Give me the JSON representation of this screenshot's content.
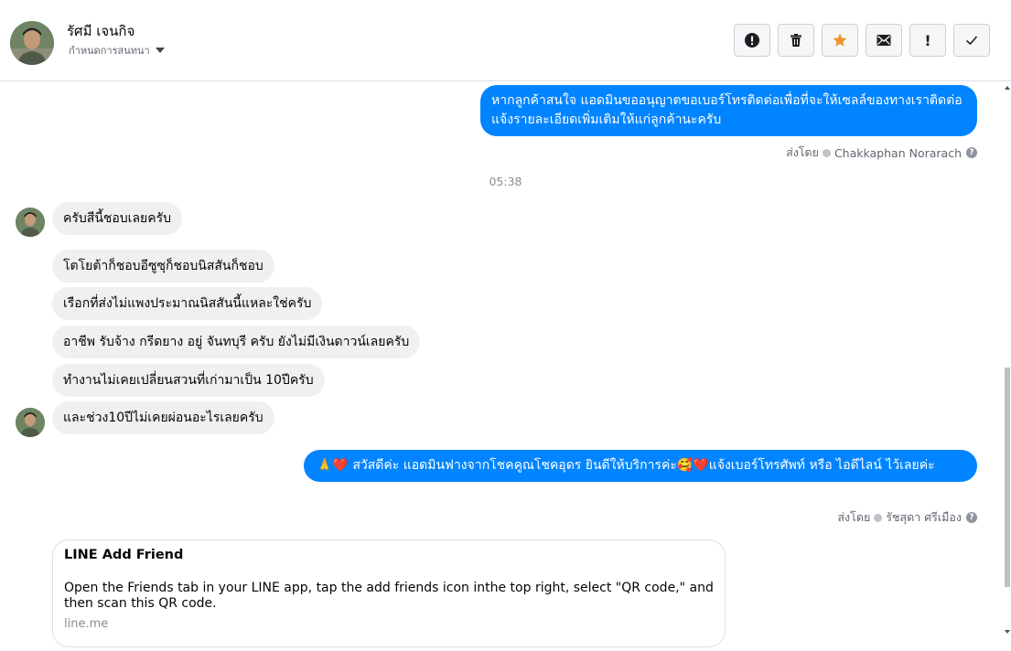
{
  "header": {
    "contact_name": "รัศมี เจนกิจ",
    "conversation_settings_label": "กำหนดการสนทนา",
    "toolbar": [
      {
        "name": "spam-button",
        "icon": "alert-circle-icon",
        "label": ""
      },
      {
        "name": "delete-button",
        "icon": "trash-icon",
        "label": ""
      },
      {
        "name": "star-button",
        "icon": "star-icon",
        "label": ""
      },
      {
        "name": "mark-unread-button",
        "icon": "envelope-icon",
        "label": ""
      },
      {
        "name": "priority-button",
        "icon": "exclamation-icon",
        "label": "!"
      },
      {
        "name": "mark-done-button",
        "icon": "checkmark-icon",
        "label": ""
      }
    ]
  },
  "colors": {
    "outgoing_bubble": "#0084ff",
    "incoming_bubble": "#f0f0f0",
    "star_accent": "#f0932b"
  },
  "messages": {
    "out_1": {
      "text": "หากลูกค้าสนใจ แอดมินขออนุญาตขอเบอร์โทรติดต่อเพื่อที่จะให้เซลล์ของทางเราติดต่อแจ้งรายละเอียดเพิ่มเติมให้แก่ลูกค้านะครับ",
      "sent_by_label": "ส่งโดย",
      "sender": "Chakkaphan Norarach"
    },
    "time_divider": "05:38",
    "in": [
      "ครับสีนี้ชอบเลยครับ",
      "โตโยต้าก็ชอบอีซูซุก็ชอบนิสสันก็ชอบ",
      "เรือกที่ส่งไม่แพงประมาณนิสสันนี้แหละใช่ครับ",
      "อาชีพ รับจ้าง กรีดยาง อยู่ จันทบุรี ครับ ยังไม่มีเงินดาวน์เลยครับ",
      "ทำงานไม่เคยเปลี่ยนสวนที่เก่ามาเป็น 10ปีครับ",
      "และช่วง10ปีไม่เคยผ่อนอะไรเลยครับ"
    ],
    "out_2": {
      "prefix_emoji": "🙏❤️",
      "text": "สวัสดีค่ะ แอดมินฟางจากโชคคูณโชคอุดร ยินดีให้บริการค่ะ🥰❤️แจ้งเบอร์โทรศัพท์ หรือ ไอดีไลน์  ไว้เลยค่ะ",
      "sent_by_label": "ส่งโดย",
      "sender": "รัชสุดา ศรีเมือง"
    },
    "link_card": {
      "title": "LINE Add Friend",
      "description": "Open the Friends tab in your LINE app, tap the add friends icon inthe top right, select \"QR code,\" and then scan this QR code.",
      "domain": "line.me"
    }
  }
}
